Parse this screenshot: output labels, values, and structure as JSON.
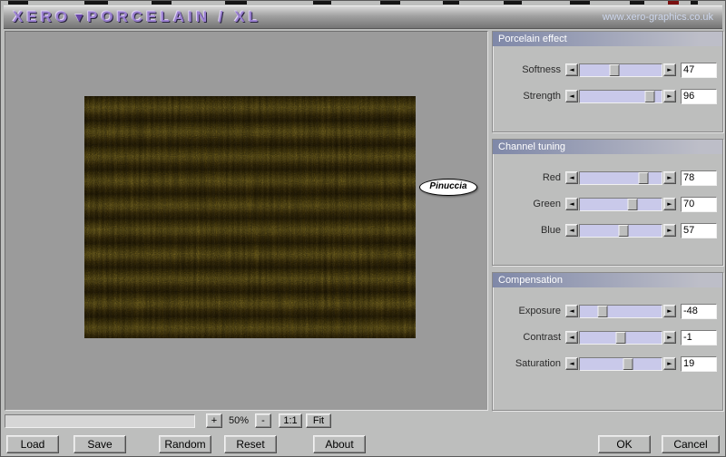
{
  "header": {
    "logo_left": "XERO",
    "logo_mark": "▼",
    "logo_right": "PORCELAIN / XL",
    "url": "www.xero-graphics.co.uk"
  },
  "preview": {
    "badge_label": "Pinuccia"
  },
  "icons": {
    "decrement": "◄",
    "increment": "►"
  },
  "groups": [
    {
      "title": "Porcelain effect",
      "sliders": [
        {
          "label": "Softness",
          "value": "47",
          "thumb_pct": 42
        },
        {
          "label": "Strength",
          "value": "96",
          "thumb_pct": 85
        }
      ]
    },
    {
      "title": "Channel tuning",
      "sliders": [
        {
          "label": "Red",
          "value": "78",
          "thumb_pct": 78
        },
        {
          "label": "Green",
          "value": "70",
          "thumb_pct": 64
        },
        {
          "label": "Blue",
          "value": "57",
          "thumb_pct": 53
        }
      ]
    },
    {
      "title": "Compensation",
      "sliders": [
        {
          "label": "Exposure",
          "value": "-48",
          "thumb_pct": 28
        },
        {
          "label": "Contrast",
          "value": "-1",
          "thumb_pct": 50
        },
        {
          "label": "Saturation",
          "value": "19",
          "thumb_pct": 59
        }
      ]
    }
  ],
  "zoom": {
    "zoom_in": "+",
    "level": "50%",
    "zoom_out": "-",
    "one_to_one": "1:1",
    "fit": "Fit"
  },
  "actions": {
    "load": "Load",
    "save": "Save",
    "random": "Random",
    "reset": "Reset",
    "about": "About",
    "ok": "OK",
    "cancel": "Cancel"
  }
}
